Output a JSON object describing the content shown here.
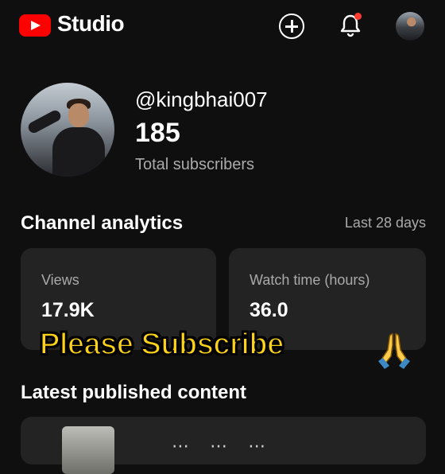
{
  "header": {
    "logo_text": "Studio",
    "icons": [
      "youtube-logo-icon",
      "create-plus-icon",
      "notifications-bell-icon",
      "account-avatar"
    ],
    "notification_dot_color": "#ff3b30",
    "brand_color": "#ff0000"
  },
  "channel": {
    "handle": "@kingbhai007",
    "subscriber_count": "185",
    "subscriber_label": "Total subscribers"
  },
  "analytics": {
    "title": "Channel analytics",
    "period": "Last 28 days",
    "cards": [
      {
        "label": "Views",
        "value": "17.9K"
      },
      {
        "label": "Watch time (hours)",
        "value": "36.0"
      }
    ]
  },
  "overlay": {
    "text": "Please Subscribe",
    "emoji_icon": "folded-hands-icon",
    "color": "#ffd21a"
  },
  "latest": {
    "title": "Latest published content"
  }
}
